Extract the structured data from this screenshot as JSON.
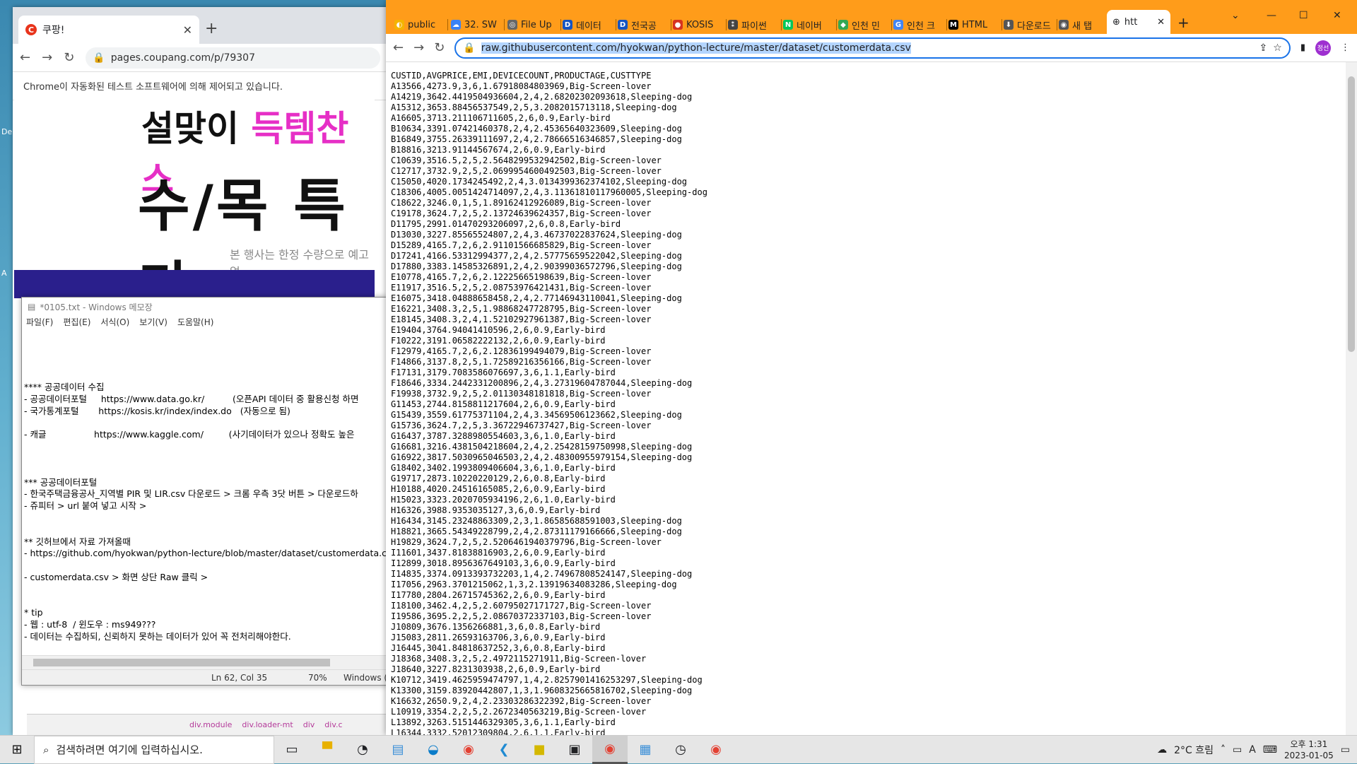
{
  "back_browser": {
    "tab_title": "쿠팡!",
    "url": "pages.coupang.com/p/79307",
    "infobar": "Chrome이 자동화된 테스트 소프트웨어에 의해 제어되고 있습니다.",
    "banner_line1_a": "설맞이 ",
    "banner_line1_b": "득템찬스",
    "banner_line2": "수/목 특가",
    "banner_note": "본 행사는 한정 수량으로 예고없",
    "devtools": [
      "div.module",
      "div.loader-mt",
      "div",
      "div.c"
    ]
  },
  "notepad": {
    "title": "*0105.txt - Windows 메모장",
    "menu": [
      "파일(F)",
      "편집(E)",
      "서식(O)",
      "보기(V)",
      "도움말(H)"
    ],
    "content": "\n\n\n\n**** 공공데이터 수집\n- 공공데이터포털     https://www.data.go.kr/          (오픈API 데이터 중 활용신청 하면\n- 국가통계포털       https://kosis.kr/index/index.do   (자동으로 됨)\n\n- 캐글                 https://www.kaggle.com/         (사기데이터가 있으나 정확도 높은\n\n\n\n*** 공공데이터포털\n- 한국주택금융공사_지역별 PIR 및 LIR.csv 다운로드 > 크롬 우측 3닷 버튼 > 다운로드하\n- 쥬피터 > url 붙여 넣고 시작 >\n\n\n** 깃허브에서 자료 가져올때\n- https://github.com/hyokwan/python-lecture/blob/master/dataset/customerdata.csv\n\n- customerdata.csv > 화면 상단 Raw 클릭 >\n\n\n* tip\n- 웹 : utf-8  / 윈도우 : ms949???\n- 데이터는 수집하되, 신뢰하지 못하는 데이터가 있어 꼭 전처리해야한다.",
    "status_pos": "Ln 62, Col 35",
    "status_zoom": "70%",
    "status_enc": "Windows ("
  },
  "front_browser": {
    "tabs": [
      "public",
      "32. SW",
      "File Up",
      "데이터",
      "전국공",
      "KOSIS",
      "파이썬",
      "네이버",
      "인천 민",
      "인천 크",
      "HTML",
      "다운로드",
      "새 탭"
    ],
    "active_tab": "htt",
    "url": "raw.githubusercontent.com/hyokwan/python-lecture/master/dataset/customerdata.csv",
    "avatar": "정선",
    "csv": "CUSTID,AVGPRICE,EMI,DEVICECOUNT,PRODUCTAGE,CUSTTYPE\nA13566,4273.9,3,6,1.67918084803969,Big-Screen-lover\nA14219,3642.4419504936604,2,4,2.68202302093618,Sleeping-dog\nA15312,3653.88456537549,2,5,3.2082015713118,Sleeping-dog\nA16605,3713.211106711605,2,6,0.9,Early-bird\nB10634,3391.07421460378,2,4,2.45365640323609,Sleeping-dog\nB16849,3755.26339111697,2,4,2.78666516346857,Sleeping-dog\nB18816,3213.91144567674,2,6,0.9,Early-bird\nC10639,3516.5,2,5,2.5648299532942502,Big-Screen-lover\nC12717,3732.9,2,5,2.0699954600492503,Big-Screen-lover\nC15050,4020.1734245492,2,4,3.0134399362374102,Sleeping-dog\nC18306,4005.0051424714097,2,4,3.11361810117960005,Sleeping-dog\nC18622,3246.0,1,5,1.89162412926089,Big-Screen-lover\nC19178,3624.7,2,5,2.13724639624357,Big-Screen-lover\nD11795,2991.01470293206097,2,6,0.8,Early-bird\nD13030,3227.85565524807,2,4,3.46737022837624,Sleeping-dog\nD15289,4165.7,2,6,2.91101566685829,Big-Screen-lover\nD17241,4166.53312994377,2,4,2.57775659522042,Sleeping-dog\nD17880,3383.14585326891,2,4,2.90399036572796,Sleeping-dog\nE10778,4165.7,2,6,2.12225665198639,Big-Screen-lover\nE11917,3516.5,2,5,2.08753976421431,Big-Screen-lover\nE16075,3418.04888658458,2,4,2.77146943110041,Sleeping-dog\nE16221,3408.3,2,5,1.98868247728795,Big-Screen-lover\nE18145,3408.3,2,4,1.52102927961387,Big-Screen-lover\nE19404,3764.94041410596,2,6,0.9,Early-bird\nF10222,3191.06582222132,2,6,0.9,Early-bird\nF12979,4165.7,2,6,2.12836199494079,Big-Screen-lover\nF14866,3137.8,2,5,1.72589216356166,Big-Screen-lover\nF17131,3179.7083586076697,3,6,1.1,Early-bird\nF18646,3334.2442331200896,2,4,3.27319604787044,Sleeping-dog\nF19938,3732.9,2,5,2.01130348181818,Big-Screen-lover\nG11453,2744.8158811217604,2,6,0.9,Early-bird\nG15439,3559.61775371104,2,4,3.34569506123662,Sleeping-dog\nG15736,3624.7,2,5,3.36722946737427,Big-Screen-lover\nG16437,3787.3288980554603,3,6,1.0,Early-bird\nG16681,3216.4381504218604,2,4,2.25428159750998,Sleeping-dog\nG16922,3817.5030965046503,2,4,2.48300955979154,Sleeping-dog\nG18402,3402.1993809406604,3,6,1.0,Early-bird\nG19717,2873.10220220129,2,6,0.8,Early-bird\nH10188,4020.24516165085,2,6,0.9,Early-bird\nH15023,3323.2020705934196,2,6,1.0,Early-bird\nH16326,3988.9353035127,3,6,0.9,Early-bird\nH16434,3145.23248863309,2,3,1.86585688591003,Sleeping-dog\nH18821,3665.54349228799,2,4,2.87311179166666,Sleeping-dog\nH19829,3624.7,2,5,2.5206461940379796,Big-Screen-lover\nI11601,3437.81838816903,2,6,0.9,Early-bird\nI12899,3018.8956367649103,3,6,0.9,Early-bird\nI14835,3374.0913393732203,1,4,2.74967808524147,Sleeping-dog\nI17056,2963.3701215062,1,3,2.13919634083286,Sleeping-dog\nI17780,2804.26715745362,2,6,0.9,Early-bird\nI18100,3462.4,2,5,2.60795027171727,Big-Screen-lover\nI19586,3695.2,2,5,2.08670372337103,Big-Screen-lover\nJ10809,3676.1356266881,3,6,0.8,Early-bird\nJ15083,2811.26593163706,3,6,0.9,Early-bird\nJ16445,3041.84818637252,3,6,0.8,Early-bird\nJ18368,3408.3,2,5,2.4972115271911,Big-Screen-lover\nJ18640,3227.8231303938,2,6,0.9,Early-bird\nK10712,3419.4625959474797,1,4,2.8257901416253297,Sleeping-dog\nK13300,3159.83920442807,1,3,1.9608325665816702,Sleeping-dog\nK16632,2650.9,2,4,2.23303286322392,Big-Screen-lover\nL10919,3354.2,2,5,2.2672340563219,Big-Screen-lover\nL13892,3263.5151446329305,3,6,1.1,Early-bird\nL16344,3332.52012309804,2,6,1.1,Early-bird"
  },
  "taskbar": {
    "search_placeholder": "검색하려면 여기에 입력하십시오.",
    "weather": "2°C 흐림",
    "time": "오후 1:31",
    "date": "2023-01-05",
    "ime": "A"
  }
}
